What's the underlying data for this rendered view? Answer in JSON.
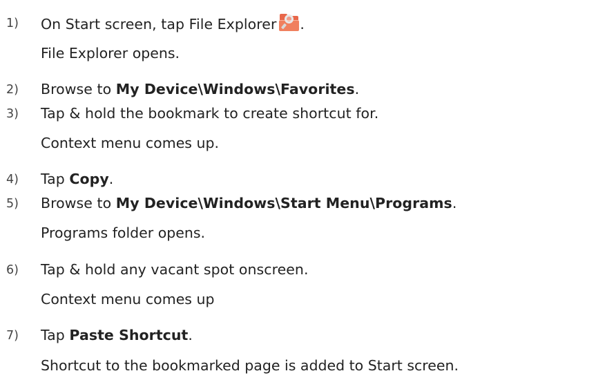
{
  "steps": [
    {
      "num": "1)",
      "text_before": "On Start screen, tap File Explorer",
      "icon": "file-explorer-icon",
      "text_after": ".",
      "result": "File Explorer opens."
    },
    {
      "num": "2)",
      "text_before": "Browse to ",
      "bold": "My Device\\Windows\\Favorites",
      "text_after": "."
    },
    {
      "num": "3)",
      "text": "Tap & hold the bookmark to create shortcut for.",
      "result": "Context menu comes up."
    },
    {
      "num": "4)",
      "text_before": "Tap ",
      "bold": "Copy",
      "text_after": "."
    },
    {
      "num": "5)",
      "text_before": "Browse to ",
      "bold": "My Device\\Windows\\Start Menu\\Programs",
      "text_after": ".",
      "result": "Programs folder opens."
    },
    {
      "num": "6)",
      "text": "Tap & hold any vacant spot onscreen.",
      "result": "Context menu comes up"
    },
    {
      "num": "7)",
      "text_before": "Tap ",
      "bold": "Paste Shortcut",
      "text_after": ".",
      "result": "Shortcut to the bookmarked page is added to Start screen."
    }
  ]
}
